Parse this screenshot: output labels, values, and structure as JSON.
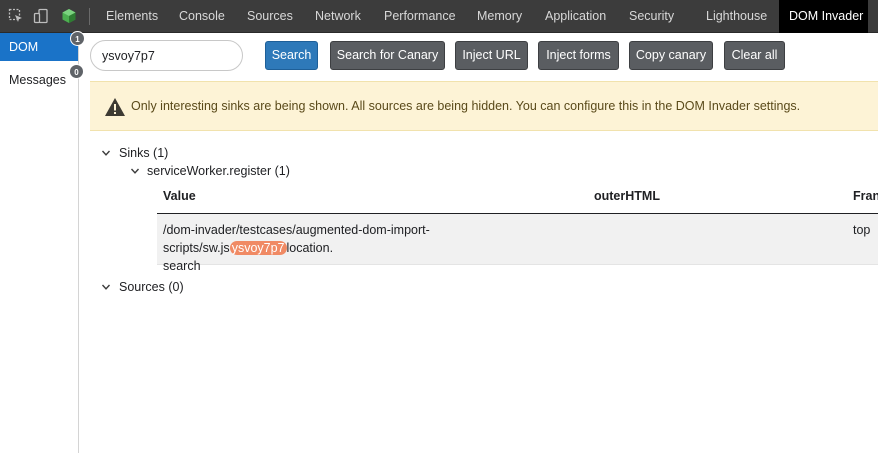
{
  "devtools_tabs": [
    {
      "label": "Elements",
      "active": false
    },
    {
      "label": "Console",
      "active": false
    },
    {
      "label": "Sources",
      "active": false
    },
    {
      "label": "Network",
      "active": false
    },
    {
      "label": "Performance",
      "active": false
    },
    {
      "label": "Memory",
      "active": false
    },
    {
      "label": "Application",
      "active": false
    },
    {
      "label": "Security",
      "active": false
    },
    {
      "label": "Lighthouse",
      "active": false
    },
    {
      "label": "DOM Invader",
      "active": true
    }
  ],
  "sidebar": {
    "items": [
      {
        "label": "DOM",
        "badge": "1",
        "active": true
      },
      {
        "label": "Messages",
        "badge": "0",
        "active": false
      }
    ]
  },
  "toolbar": {
    "search_value": "ysvoy7p7",
    "buttons": {
      "search": "Search",
      "search_canary": "Search for Canary",
      "inject_url": "Inject URL",
      "inject_forms": "Inject forms",
      "copy_canary": "Copy canary",
      "clear_all": "Clear all"
    }
  },
  "warning": {
    "text": "Only interesting sinks are being shown. All sources are being hidden. You can configure this in the DOM Invader settings."
  },
  "sinks": {
    "label": "Sinks (1)",
    "groups": [
      {
        "label": "serviceWorker.register (1)",
        "columns": {
          "value": "Value",
          "outer_html": "outerHTML",
          "frame": "Fran"
        },
        "rows": [
          {
            "value_before": "/dom-invader/testcases/augmented-dom-import-scripts/sw.js",
            "value_canary": "ysvoy7p7",
            "value_after": "location.",
            "value_line2": "search",
            "outer_html": "",
            "frame": "top"
          }
        ]
      }
    ]
  },
  "sources": {
    "label": "Sources (0)"
  },
  "colors": {
    "accent": "#1a73c8",
    "primary_button": "#2e79b9",
    "secondary_button": "#5a5d61",
    "warning_bg": "#fdf3d6",
    "canary_highlight": "#f08a64"
  }
}
